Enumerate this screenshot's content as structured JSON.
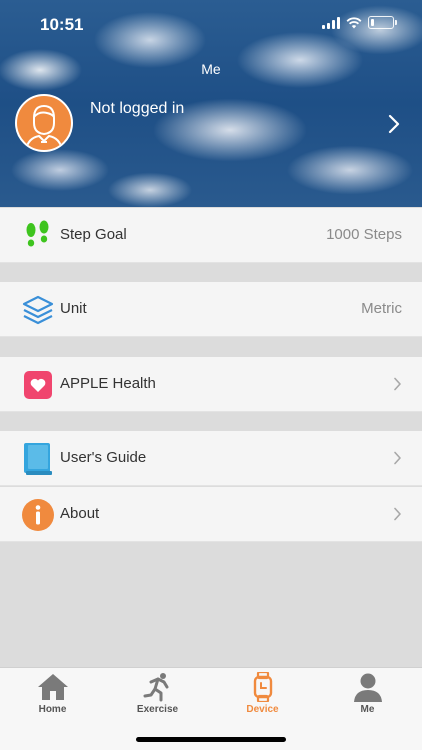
{
  "status": {
    "time": "10:51"
  },
  "header": {
    "title": "Me",
    "profile_name": "Not logged in"
  },
  "settings": {
    "step_goal": {
      "label": "Step Goal",
      "value": "1000 Steps"
    },
    "unit": {
      "label": "Unit",
      "value": "Metric"
    },
    "apple_health": {
      "label": "APPLE Health"
    },
    "users_guide": {
      "label": "User's Guide"
    },
    "about": {
      "label": "About"
    }
  },
  "tabs": [
    {
      "label": "Home",
      "icon": "home-icon"
    },
    {
      "label": "Exercise",
      "icon": "running-icon"
    },
    {
      "label": "Device",
      "icon": "watch-icon"
    },
    {
      "label": "Me",
      "icon": "person-icon"
    }
  ],
  "colors": {
    "accent": "#f08a3e",
    "tab_inactive": "#555555",
    "step_icon": "#3ec41e",
    "unit_icon": "#3a8fd8",
    "health_icon": "#f0456e",
    "guide_icon": "#34a5de",
    "about_icon": "#f08a3e"
  }
}
